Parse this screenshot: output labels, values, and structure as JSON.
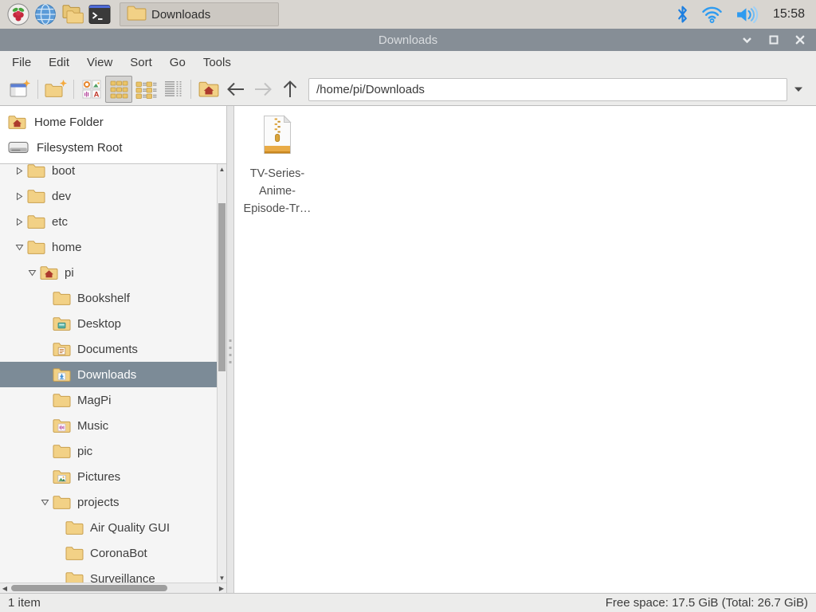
{
  "taskbar": {
    "launchers": [
      {
        "icon": "raspberry",
        "name": "raspberry-menu"
      },
      {
        "icon": "globe",
        "name": "web-browser"
      },
      {
        "icon": "file-manager",
        "name": "file-manager"
      },
      {
        "icon": "terminal",
        "name": "terminal"
      }
    ],
    "task_button_label": "Downloads",
    "tray": [
      "bluetooth",
      "wifi",
      "volume"
    ],
    "time": "15:58"
  },
  "window": {
    "title": "Downloads"
  },
  "menubar": {
    "items": [
      "File",
      "Edit",
      "View",
      "Sort",
      "Go",
      "Tools"
    ]
  },
  "toolbar": {
    "path_value": "/home/pi/Downloads"
  },
  "sidebar": {
    "places": [
      {
        "label": "Home Folder",
        "icon": "folder-home"
      },
      {
        "label": "Filesystem Root",
        "icon": "drive"
      }
    ],
    "tree": [
      {
        "label": "boot",
        "icon": "folder",
        "expander": "collapsed",
        "level": 0
      },
      {
        "label": "dev",
        "icon": "folder",
        "expander": "collapsed",
        "level": 0
      },
      {
        "label": "etc",
        "icon": "folder",
        "expander": "collapsed",
        "level": 0
      },
      {
        "label": "home",
        "icon": "folder",
        "expander": "expanded",
        "level": 0
      },
      {
        "label": "pi",
        "icon": "folder-home",
        "expander": "expanded",
        "level": 1
      },
      {
        "label": "Bookshelf",
        "icon": "folder",
        "expander": "none",
        "level": 2
      },
      {
        "label": "Desktop",
        "icon": "folder-desktop",
        "expander": "none",
        "level": 2
      },
      {
        "label": "Documents",
        "icon": "folder-documents",
        "expander": "none",
        "level": 2
      },
      {
        "label": "Downloads",
        "icon": "folder-downloads",
        "expander": "none",
        "level": 2,
        "selected": true
      },
      {
        "label": "MagPi",
        "icon": "folder",
        "expander": "none",
        "level": 2
      },
      {
        "label": "Music",
        "icon": "folder-music",
        "expander": "none",
        "level": 2
      },
      {
        "label": "pic",
        "icon": "folder",
        "expander": "none",
        "level": 2
      },
      {
        "label": "Pictures",
        "icon": "folder-pictures",
        "expander": "none",
        "level": 2
      },
      {
        "label": "projects",
        "icon": "folder",
        "expander": "expanded",
        "level": 2
      },
      {
        "label": "Air Quality GUI",
        "icon": "folder",
        "expander": "none",
        "level": 3
      },
      {
        "label": "CoronaBot",
        "icon": "folder",
        "expander": "none",
        "level": 3
      },
      {
        "label": "Surveillance",
        "icon": "folder",
        "expander": "none",
        "level": 3
      }
    ]
  },
  "main": {
    "files": [
      {
        "icon": "zip",
        "display_lines": [
          "TV-Series-",
          "Anime-",
          "Episode-Tr…"
        ]
      }
    ]
  },
  "statusbar": {
    "left_text": "1 item",
    "right_text": "Free space: 17.5 GiB (Total: 26.7 GiB)"
  },
  "colors": {
    "selection": "#7c8b97",
    "titlebar": "#868e96",
    "folder": "#f2d186",
    "tray_blue": "#2e9bf0"
  }
}
